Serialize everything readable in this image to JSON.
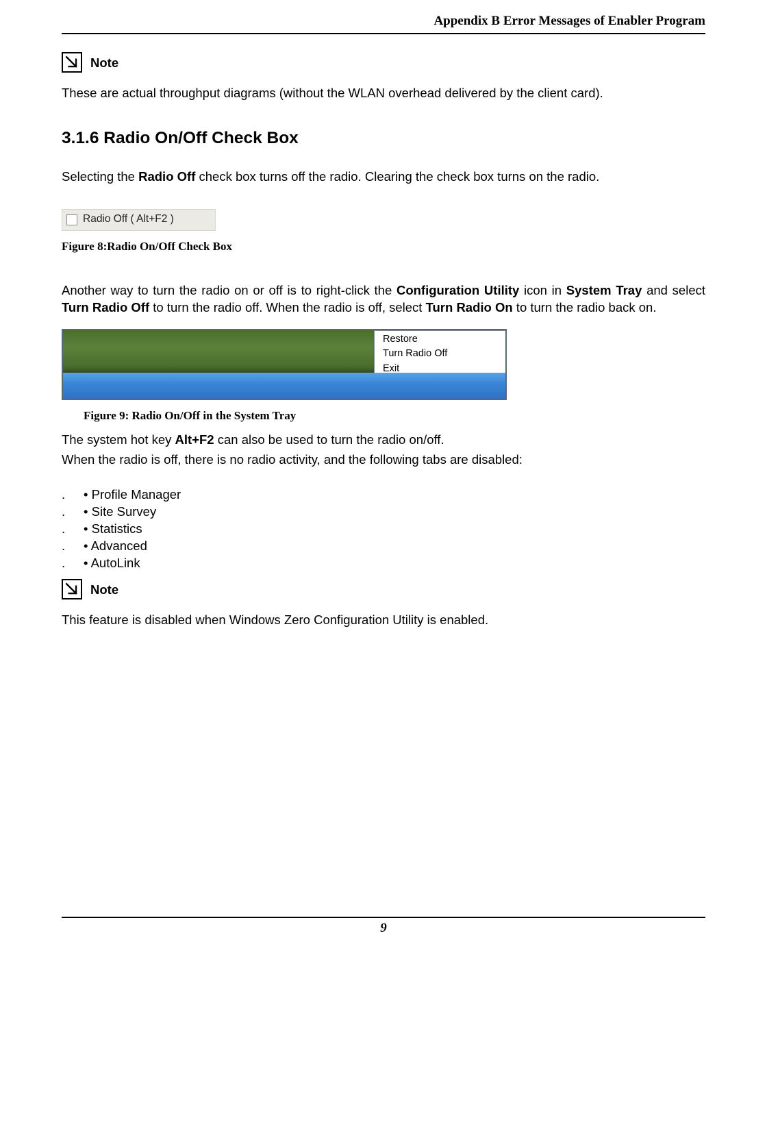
{
  "header": {
    "title": "Appendix B Error Messages of Enabler Program"
  },
  "note1": {
    "label": "Note",
    "text": "These are actual throughput diagrams (without the WLAN overhead delivered by the client card)."
  },
  "section": {
    "heading": "3.1.6 Radio On/Off Check Box"
  },
  "para1": {
    "pre": "Selecting the ",
    "bold1": "Radio Off",
    "post": " check box turns off the radio. Clearing the check box turns on the radio."
  },
  "figure8": {
    "checkbox_label": "Radio Off  ( Alt+F2 )",
    "caption": "Figure 8:Radio On/Off Check Box"
  },
  "para2": {
    "seg1": "Another way to turn the radio on or off is to right-click the ",
    "b1": "Configuration Utility",
    "seg2": " icon in ",
    "b2": "System Tray",
    "seg3": " and select ",
    "b3": "Turn Radio Off",
    "seg4": " to turn the radio off. When the radio is off, select ",
    "b4": "Turn Radio On",
    "seg5": " to turn the radio back on."
  },
  "figure9": {
    "menu_items": {
      "i0": "Restore",
      "i1": "Turn Radio Off",
      "i2": "Exit"
    },
    "caption": "Figure 9: Radio On/Off in the System Tray"
  },
  "para3": {
    "seg1": "The system hot key ",
    "b1": "Alt+F2",
    "seg2": " can also be used to turn the radio on/off."
  },
  "para4": "When the radio is off, there is no radio activity, and the following tabs are disabled:",
  "list": {
    "dot": ".",
    "i0": "• Profile Manager",
    "i1": "• Site Survey",
    "i2": "• Statistics",
    "i3": "• Advanced",
    "i4": "• AutoLink"
  },
  "note2": {
    "label": "Note",
    "text": "This feature is disabled when Windows Zero Configuration Utility is enabled."
  },
  "footer": {
    "page": "9"
  }
}
